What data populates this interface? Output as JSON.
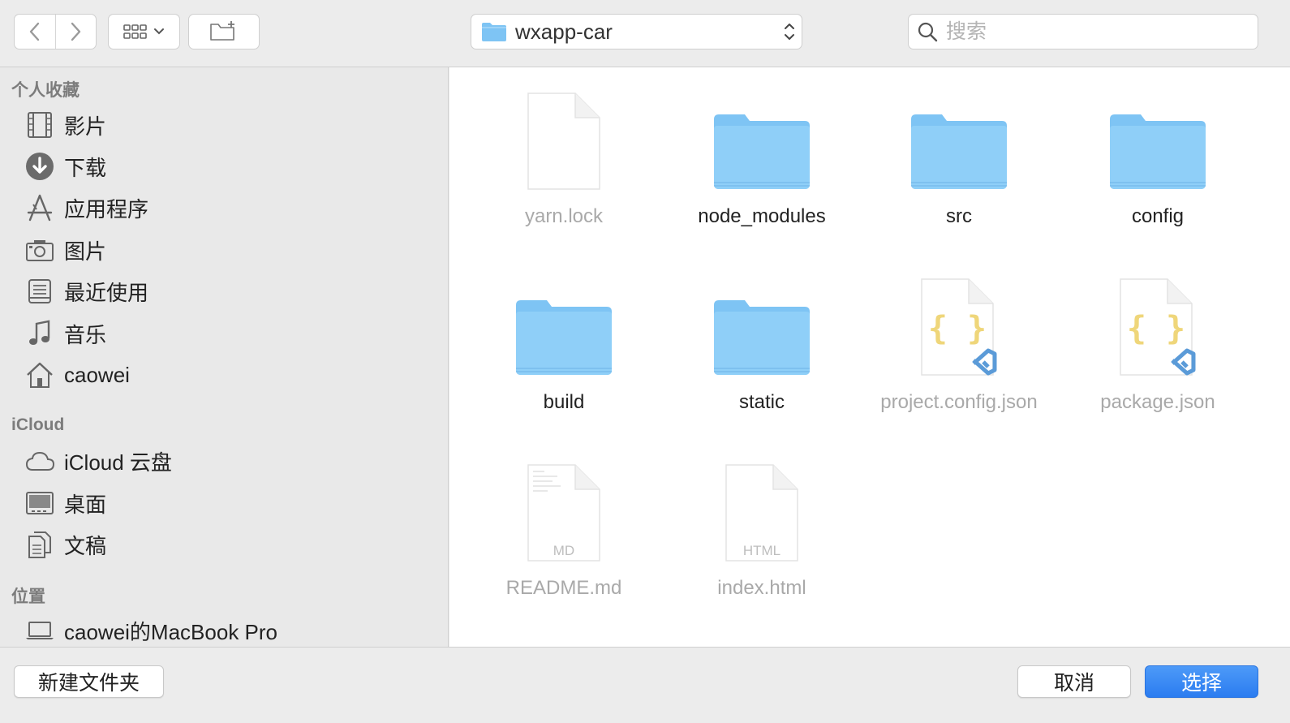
{
  "toolbar": {
    "path_label": "wxapp-car",
    "search_placeholder": "搜索"
  },
  "sidebar": {
    "favorites_title": "个人收藏",
    "favorites": [
      {
        "label": "影片",
        "icon": "film-icon"
      },
      {
        "label": "下载",
        "icon": "download-icon"
      },
      {
        "label": "应用程序",
        "icon": "applications-icon"
      },
      {
        "label": "图片",
        "icon": "camera-icon"
      },
      {
        "label": "最近使用",
        "icon": "recents-icon"
      },
      {
        "label": "音乐",
        "icon": "music-icon"
      },
      {
        "label": "caowei",
        "icon": "home-icon"
      }
    ],
    "icloud_title": "iCloud",
    "icloud": [
      {
        "label": "iCloud 云盘",
        "icon": "cloud-icon"
      },
      {
        "label": "桌面",
        "icon": "desktop-icon"
      },
      {
        "label": "文稿",
        "icon": "documents-icon"
      }
    ],
    "locations_title": "位置",
    "locations": [
      {
        "label": "caowei的MacBook Pro",
        "icon": "laptop-icon"
      }
    ]
  },
  "files": [
    {
      "name": "yarn.lock",
      "type": "doc",
      "dim": true
    },
    {
      "name": "node_modules",
      "type": "folder",
      "dim": false
    },
    {
      "name": "src",
      "type": "folder",
      "dim": false
    },
    {
      "name": "config",
      "type": "folder",
      "dim": false
    },
    {
      "name": "build",
      "type": "folder",
      "dim": false
    },
    {
      "name": "static",
      "type": "folder",
      "dim": false
    },
    {
      "name": "project.config.json",
      "type": "json",
      "dim": true
    },
    {
      "name": "package.json",
      "type": "json",
      "dim": true
    },
    {
      "name": "README.md",
      "type": "md",
      "dim": true,
      "badge": "MD"
    },
    {
      "name": "index.html",
      "type": "html",
      "dim": true,
      "badge": "HTML"
    }
  ],
  "bottom": {
    "new_folder_label": "新建文件夹",
    "cancel_label": "取消",
    "choose_label": "选择"
  },
  "colors": {
    "folder": "#7ec4f4",
    "primary_button": "#2b7cf0",
    "json_braces": "#efd67a",
    "vscode": "#5b9bd8"
  }
}
